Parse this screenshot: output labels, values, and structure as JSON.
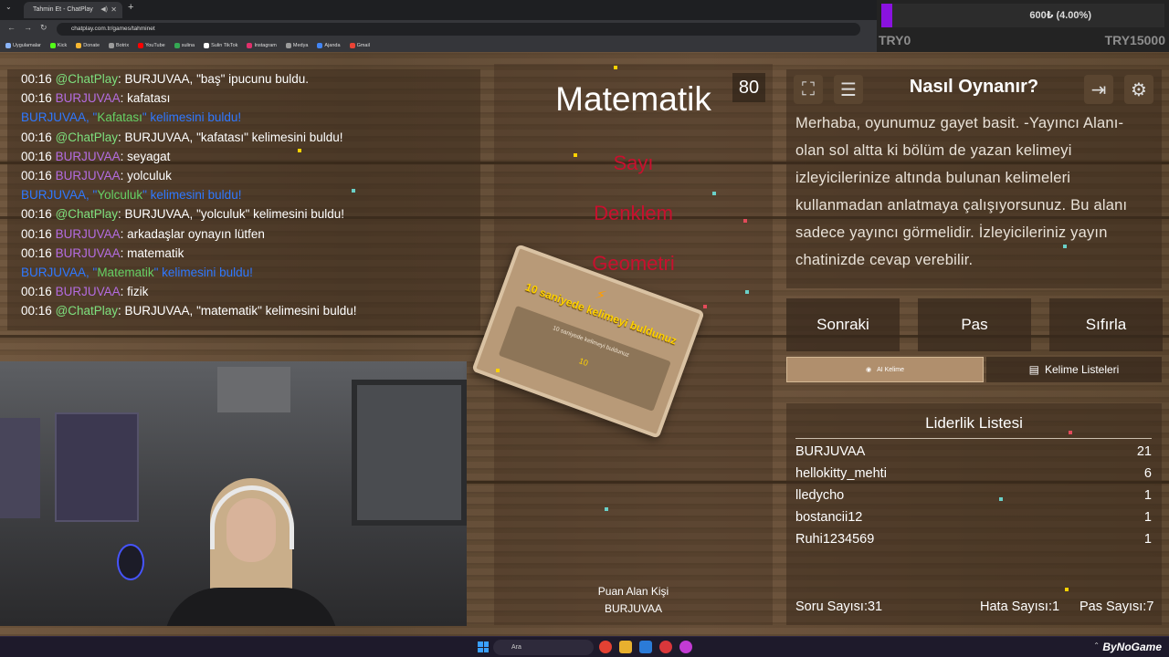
{
  "browser": {
    "tab_title": "Tahmin Et - ChatPlay",
    "url": "chatplay.com.tr/games/tahminet",
    "bookmarks": [
      "Uygulamalar",
      "Kick",
      "Donate",
      "Botrix",
      "YouTube",
      "sulina",
      "Sulin TikTok",
      "Instagram",
      "Medya",
      "Ajanda",
      "Gmail"
    ]
  },
  "goal": {
    "text": "600₺ (4.00%)",
    "progress_percent": 4.0,
    "start_label": "TRY0",
    "end_label": "TRY15000",
    "color": "#8a12e0"
  },
  "chat": {
    "lines": [
      {
        "time": "00:16",
        "user": "@ChatPlay",
        "user_type": "bot",
        "msg": ": BURJUVAA, \"baş\" ipucunu buldu."
      },
      {
        "time": "00:16",
        "user": "BURJUVAA",
        "user_type": "user",
        "msg": ": kafatası"
      },
      {
        "time": "",
        "user": "BURJUVAA, \"",
        "user_type": "event",
        "word": "Kafatası",
        "after": "\" kelimesini buldu!"
      },
      {
        "time": "00:16",
        "user": "@ChatPlay",
        "user_type": "bot",
        "msg": ": BURJUVAA, \"kafatası\" kelimesini buldu!"
      },
      {
        "time": "00:16",
        "user": "BURJUVAA",
        "user_type": "user",
        "msg": ": seyagat"
      },
      {
        "time": "00:16",
        "user": "BURJUVAA",
        "user_type": "user",
        "msg": ": yolculuk"
      },
      {
        "time": "",
        "user": "BURJUVAA, \"",
        "user_type": "event",
        "word": "Yolculuk",
        "after": "\" kelimesini buldu!"
      },
      {
        "time": "00:16",
        "user": "@ChatPlay",
        "user_type": "bot",
        "msg": ": BURJUVAA, \"yolculuk\" kelimesini buldu!"
      },
      {
        "time": "00:16",
        "user": "BURJUVAA",
        "user_type": "user",
        "msg": ": arkadaşlar oynayın lütfen"
      },
      {
        "time": "00:16",
        "user": "BURJUVAA",
        "user_type": "user",
        "msg": ": matematik"
      },
      {
        "time": "",
        "user": "BURJUVAA, \"",
        "user_type": "event",
        "word": "Matematik",
        "after": "\" kelimesini buldu!"
      },
      {
        "time": "00:16",
        "user": "BURJUVAA",
        "user_type": "user",
        "msg": ": fizik"
      },
      {
        "time": "00:16",
        "user": "@ChatPlay",
        "user_type": "bot",
        "msg": ": BURJUVAA, \"matematik\" kelimesini buldu!"
      }
    ]
  },
  "game": {
    "word": "Matematik",
    "timer": "80",
    "forbidden": [
      "Sayı",
      "Denklem",
      "Geometri"
    ],
    "scorer_label": "Puan Alan Kişi",
    "scorer_name": "BURJUVAA",
    "card": {
      "title": "10 saniyede kelimeyi buldunuz",
      "subtitle": "10 saniyede kelimeyi buldunuz",
      "number": "10",
      "bolt_icon": "lightning-icon"
    }
  },
  "instructions": {
    "title": "Nasıl Oynanır?",
    "body": "Merhaba, oyunumuz gayet basit. -Yayıncı Alanı- olan sol altta ki bölüm de yazan kelimeyi izleyicilerinize altında bulunan kelimeleri kullanmadan anlatmaya çalışıyorsunuz. Bu alanı sadece yayıncı görmelidir. İzleyicileriniz yayın chatinizde cevap verebilir.",
    "icons": [
      "fullscreen-icon",
      "document-icon",
      "exit-icon",
      "gear-icon"
    ]
  },
  "controls": {
    "next": "Sonraki",
    "pass": "Pas",
    "reset": "Sıfırla",
    "ai_word": "AI Kelime",
    "word_lists": "Kelime Listeleri"
  },
  "leaderboard": {
    "title": "Liderlik Listesi",
    "rows": [
      {
        "name": "BURJUVAA",
        "score": "21"
      },
      {
        "name": "hellokitty_mehti",
        "score": "6"
      },
      {
        "name": "lledycho",
        "score": "1"
      },
      {
        "name": "bostancii12",
        "score": "1"
      },
      {
        "name": "Ruhi1234569",
        "score": "1"
      }
    ],
    "questions": "Soru Sayısı:31",
    "errors": "Hata Sayısı:1",
    "passes": "Pas Sayısı:7"
  },
  "taskbar": {
    "search_placeholder": "Ara",
    "watermark": "ByNoGame"
  }
}
